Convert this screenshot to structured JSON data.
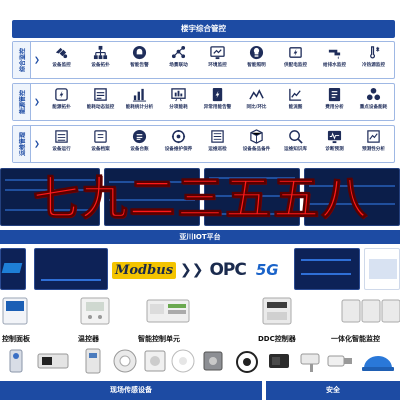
{
  "header": {
    "title": "楼宇综合管控"
  },
  "rows": [
    {
      "label": "综合监控",
      "items": [
        {
          "label": "设备监控",
          "icon": "monitor-icon"
        },
        {
          "label": "设备拓扑",
          "icon": "topology-icon"
        },
        {
          "label": "智能告警",
          "icon": "alarm-icon"
        },
        {
          "label": "场景联动",
          "icon": "link-icon"
        },
        {
          "label": "环境监控",
          "icon": "environment-icon"
        },
        {
          "label": "智能照明",
          "icon": "lighting-icon"
        },
        {
          "label": "供配电监控",
          "icon": "power-icon"
        },
        {
          "label": "给排水监控",
          "icon": "water-icon"
        },
        {
          "label": "冷热源监控",
          "icon": "hvac-icon"
        }
      ]
    },
    {
      "label": "能源管控",
      "items": [
        {
          "label": "能源拓扑",
          "icon": "energy-topology-icon"
        },
        {
          "label": "能耗动态监控",
          "icon": "energy-monitor-icon"
        },
        {
          "label": "能耗统计分析",
          "icon": "statistics-icon"
        },
        {
          "label": "分项能耗",
          "icon": "subitem-icon"
        },
        {
          "label": "异常用能告警",
          "icon": "abnormal-icon"
        },
        {
          "label": "同比/环比",
          "icon": "compare-icon"
        },
        {
          "label": "能流图",
          "icon": "flow-icon"
        },
        {
          "label": "费用分析",
          "icon": "cost-icon"
        },
        {
          "label": "重点设备能耗",
          "icon": "key-device-icon"
        }
      ]
    },
    {
      "label": "运维管理",
      "items": [
        {
          "label": "设备运行",
          "icon": "device-run-icon"
        },
        {
          "label": "设备档案",
          "icon": "archive-icon"
        },
        {
          "label": "设备台账",
          "icon": "ledger-icon"
        },
        {
          "label": "设备维护保养",
          "icon": "maintenance-icon"
        },
        {
          "label": "运维巡检",
          "icon": "inspection-icon"
        },
        {
          "label": "设备备品备件",
          "icon": "spare-parts-icon"
        },
        {
          "label": "运维知识库",
          "icon": "knowledge-icon"
        },
        {
          "label": "诊断预测",
          "icon": "diagnosis-icon"
        },
        {
          "label": "预测性分析",
          "icon": "predict-icon"
        }
      ]
    }
  ],
  "banner": {
    "text": "七九二三五五八"
  },
  "platform": {
    "title": "亚川IOT平台",
    "protocols": {
      "modbus": "Modbus",
      "opc": "OPC",
      "fiveg": "5G"
    }
  },
  "devices": [
    {
      "label": "控制面板",
      "icon": "control-panel-icon"
    },
    {
      "label": "温控器",
      "icon": "thermostat-icon"
    },
    {
      "label": "智能控制单元",
      "icon": "control-unit-icon"
    },
    {
      "label": "DDC控制器",
      "icon": "ddc-controller-icon"
    },
    {
      "label": "一体化智能监控",
      "icon": "integrated-monitor-icon"
    }
  ],
  "bottom": {
    "left_title": "现场传感设备",
    "right_title": "安全"
  },
  "colors": {
    "primary": "#1d4ba3",
    "banner": "#ff1a1a",
    "icon": "#1f2d5a"
  }
}
